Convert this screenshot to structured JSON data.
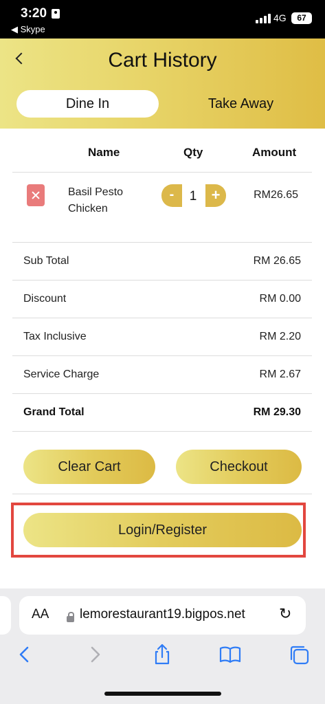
{
  "status_bar": {
    "time": "3:20",
    "back_app": "◀ Skype",
    "network": "4G",
    "battery": "67"
  },
  "header": {
    "title": "Cart History",
    "tabs": [
      {
        "label": "Dine In",
        "active": true
      },
      {
        "label": "Take Away",
        "active": false
      }
    ]
  },
  "table": {
    "headers": {
      "name": "Name",
      "qty": "Qty",
      "amount": "Amount"
    },
    "items": [
      {
        "name": "Basil Pesto Chicken",
        "qty": "1",
        "amount": "RM26.65",
        "minus": "-",
        "plus": "+"
      }
    ]
  },
  "summary": [
    {
      "label": "Sub Total",
      "value": "RM 26.65"
    },
    {
      "label": "Discount",
      "value": "RM 0.00"
    },
    {
      "label": "Tax Inclusive",
      "value": "RM 2.20"
    },
    {
      "label": "Service Charge",
      "value": "RM 2.67"
    },
    {
      "label": "Grand Total",
      "value": "RM 29.30"
    }
  ],
  "actions": {
    "clear_cart": "Clear Cart",
    "checkout": "Checkout",
    "login_register": "Login/Register"
  },
  "browser": {
    "aa": "AA",
    "url": "lemorestaurant19.bigpos.net"
  },
  "colors": {
    "gold_start": "#ece486",
    "gold_end": "#dcba44",
    "remove_red": "#e97b7b",
    "highlight_red": "#e2473f",
    "ios_blue": "#2f7cf6"
  },
  "icons": [
    "contact-icon",
    "signal-icon",
    "battery-icon",
    "back-chevron-icon",
    "close-icon",
    "lock-icon",
    "reload-icon",
    "back-arrow-icon",
    "forward-arrow-icon",
    "share-icon",
    "bookmarks-icon",
    "tabs-icon"
  ]
}
